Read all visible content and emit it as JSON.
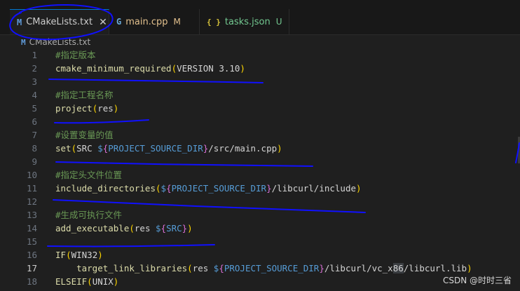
{
  "tabs": [
    {
      "icon": "M",
      "label": "CMakeLists.txt",
      "badge": "",
      "close": "✕",
      "active": true
    },
    {
      "icon": "G",
      "label": "main.cpp",
      "badge": "M"
    },
    {
      "icon": "{ }",
      "label": "tasks.json",
      "badge": "U"
    }
  ],
  "breadcrumb": {
    "icon": "M",
    "label": "CMakeLists.txt"
  },
  "code": {
    "l1": "#指定版本",
    "l2_fn": "cmake_minimum_required",
    "l2_arg": "VERSION 3.10",
    "l4": "#指定工程名称",
    "l5_fn": "project",
    "l5_arg": "res",
    "l7": "#设置变量的值",
    "l8_fn": "set",
    "l8_a": "SRC ",
    "l8_var": "PROJECT_SOURCE_DIR",
    "l8_b": "/src/main.cpp",
    "l10": "#指定头文件位置",
    "l11_fn": "include_directories",
    "l11_var": "PROJECT_SOURCE_DIR",
    "l11_b": "/libcurl/include",
    "l13": "#生成可执行文件",
    "l14_fn": "add_executable",
    "l14_a": "res ",
    "l14_var": "SRC",
    "l16_fn": "IF",
    "l16_arg": "WIN32",
    "l17_fn": "target_link_libraries",
    "l17_a": "res ",
    "l17_var": "PROJECT_SOURCE_DIR",
    "l17_b": "/libcurl/vc_x",
    "l17_sel": "86",
    "l17_c": "/libcurl.lib",
    "l18_fn": "ELSEIF",
    "l18_arg": "UNIX"
  },
  "watermark": "CSDN @时时三省",
  "colors": {
    "accent": "#0078d4",
    "annotation_ink": "#1010ff",
    "comment": "#6a9955",
    "function": "#dcdcaa"
  }
}
